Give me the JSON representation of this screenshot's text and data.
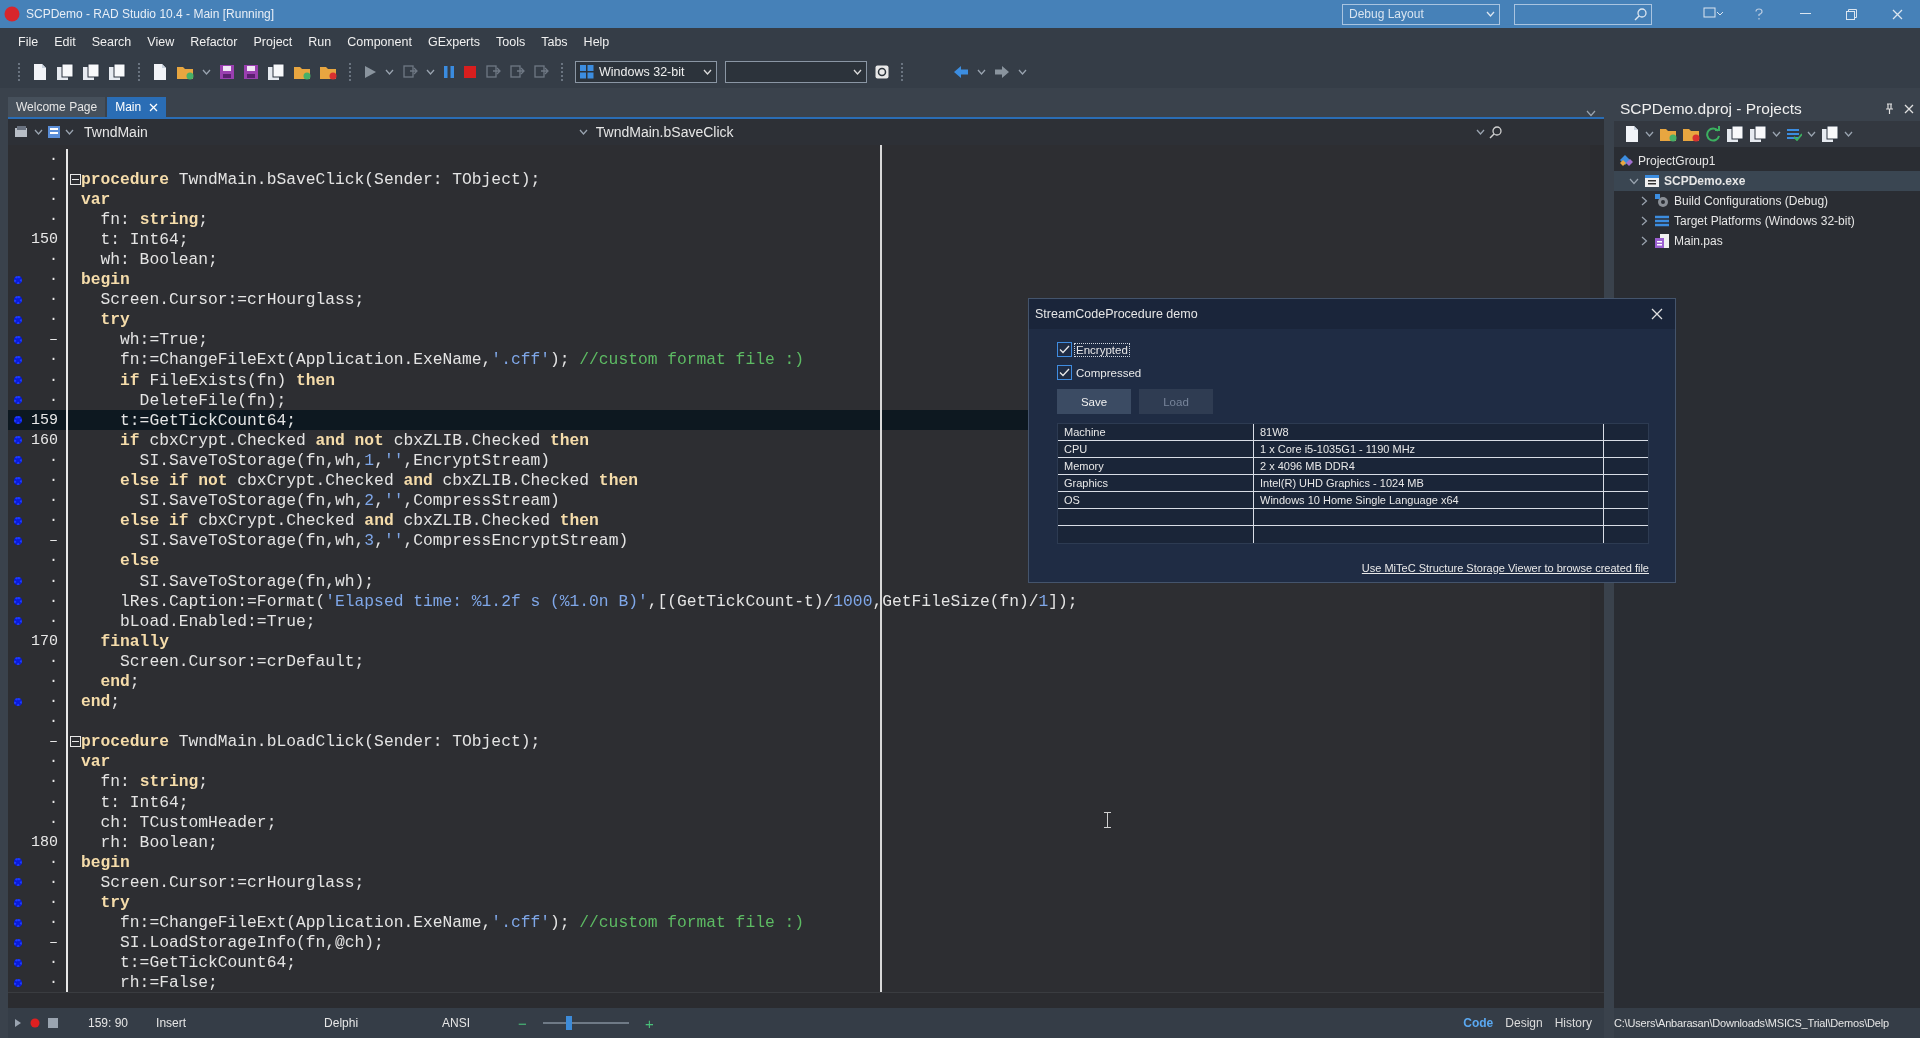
{
  "window": {
    "title": "SCPDemo - RAD Studio 10.4 - Main [Running]",
    "layout_combo": "Debug Layout"
  },
  "menu": [
    "File",
    "Edit",
    "Search",
    "View",
    "Refactor",
    "Project",
    "Run",
    "Component",
    "GExperts",
    "Tools",
    "Tabs",
    "Help"
  ],
  "toolbar": {
    "platform_combo": "Windows 32-bit"
  },
  "doc_tabs": [
    {
      "label": "Welcome Page",
      "selected": false
    },
    {
      "label": "Main",
      "selected": true
    }
  ],
  "editor": {
    "class_combo": "TwndMain",
    "method_combo": "TwndMain.bSaveClick",
    "lines": [
      {
        "gutter": "·",
        "compiled": false,
        "current": false,
        "fold": false
      },
      {
        "gutter": "·",
        "compiled": false,
        "current": false,
        "fold": true,
        "code": [
          {
            "kind": "kw",
            "text": "procedure"
          },
          {
            "kind": "plain",
            "text": " TwndMain.bSaveClick(Sender: TObject);"
          }
        ]
      },
      {
        "gutter": "·",
        "compiled": false,
        "current": false,
        "fold": false,
        "code": [
          {
            "kind": "kw",
            "text": "var"
          }
        ]
      },
      {
        "gutter": "·",
        "compiled": false,
        "current": false,
        "fold": false,
        "code": [
          {
            "kind": "plain",
            "text": "  fn: "
          },
          {
            "kind": "kw",
            "text": "string"
          },
          {
            "kind": "plain",
            "text": ";"
          }
        ]
      },
      {
        "gutter": "150",
        "compiled": false,
        "current": false,
        "fold": false,
        "code": [
          {
            "kind": "plain",
            "text": "  t: Int64;"
          }
        ]
      },
      {
        "gutter": "·",
        "compiled": false,
        "current": false,
        "fold": false,
        "code": [
          {
            "kind": "plain",
            "text": "  wh: Boolean;"
          }
        ]
      },
      {
        "gutter": "·",
        "compiled": true,
        "current": false,
        "fold": false,
        "code": [
          {
            "kind": "kw",
            "text": "begin"
          }
        ]
      },
      {
        "gutter": "·",
        "compiled": true,
        "current": false,
        "fold": false,
        "code": [
          {
            "kind": "plain",
            "text": "  Screen.Cursor:=crHourglass;"
          }
        ]
      },
      {
        "gutter": "·",
        "compiled": true,
        "current": false,
        "fold": false,
        "code": [
          {
            "kind": "kw",
            "text": "  try"
          }
        ]
      },
      {
        "gutter": "–",
        "compiled": true,
        "current": false,
        "fold": false,
        "code": [
          {
            "kind": "plain",
            "text": "    wh:=True;"
          }
        ]
      },
      {
        "gutter": "·",
        "compiled": true,
        "current": false,
        "fold": false,
        "code": [
          {
            "kind": "plain",
            "text": "    fn:=ChangeFileExt(Application.ExeName,"
          },
          {
            "kind": "str",
            "text": "'.cff'"
          },
          {
            "kind": "plain",
            "text": "); "
          },
          {
            "kind": "cmt",
            "text": "//custom format file :)"
          }
        ]
      },
      {
        "gutter": "·",
        "compiled": true,
        "current": false,
        "fold": false,
        "code": [
          {
            "kind": "kw",
            "text": "    if"
          },
          {
            "kind": "plain",
            "text": " FileExists(fn) "
          },
          {
            "kind": "kw",
            "text": "then"
          }
        ]
      },
      {
        "gutter": "·",
        "compiled": true,
        "current": false,
        "fold": false,
        "code": [
          {
            "kind": "plain",
            "text": "      DeleteFile(fn);"
          }
        ]
      },
      {
        "gutter": "159",
        "compiled": true,
        "current": true,
        "fold": false,
        "code": [
          {
            "kind": "plain",
            "text": "    t:=GetTickCount64;"
          }
        ]
      },
      {
        "gutter": "160",
        "compiled": true,
        "current": false,
        "fold": false,
        "code": [
          {
            "kind": "kw",
            "text": "    if"
          },
          {
            "kind": "plain",
            "text": " cbxCrypt.Checked "
          },
          {
            "kind": "kw",
            "text": "and not"
          },
          {
            "kind": "plain",
            "text": " cbxZLIB.Checked "
          },
          {
            "kind": "kw",
            "text": "then"
          }
        ]
      },
      {
        "gutter": "·",
        "compiled": true,
        "current": false,
        "fold": false,
        "code": [
          {
            "kind": "plain",
            "text": "      SI.SaveToStorage(fn,wh,"
          },
          {
            "kind": "num",
            "text": "1"
          },
          {
            "kind": "plain",
            "text": ","
          },
          {
            "kind": "str",
            "text": "''"
          },
          {
            "kind": "plain",
            "text": ",EncryptStream)"
          }
        ]
      },
      {
        "gutter": "·",
        "compiled": true,
        "current": false,
        "fold": false,
        "code": [
          {
            "kind": "kw",
            "text": "    else if not"
          },
          {
            "kind": "plain",
            "text": " cbxCrypt.Checked "
          },
          {
            "kind": "kw",
            "text": "and"
          },
          {
            "kind": "plain",
            "text": " cbxZLIB.Checked "
          },
          {
            "kind": "kw",
            "text": "then"
          }
        ]
      },
      {
        "gutter": "·",
        "compiled": true,
        "current": false,
        "fold": false,
        "code": [
          {
            "kind": "plain",
            "text": "      SI.SaveToStorage(fn,wh,"
          },
          {
            "kind": "num",
            "text": "2"
          },
          {
            "kind": "plain",
            "text": ","
          },
          {
            "kind": "str",
            "text": "''"
          },
          {
            "kind": "plain",
            "text": ",CompressStream)"
          }
        ]
      },
      {
        "gutter": "·",
        "compiled": true,
        "current": false,
        "fold": false,
        "code": [
          {
            "kind": "kw",
            "text": "    else if"
          },
          {
            "kind": "plain",
            "text": " cbxCrypt.Checked "
          },
          {
            "kind": "kw",
            "text": "and"
          },
          {
            "kind": "plain",
            "text": " cbxZLIB.Checked "
          },
          {
            "kind": "kw",
            "text": "then"
          }
        ]
      },
      {
        "gutter": "–",
        "compiled": true,
        "current": false,
        "fold": false,
        "code": [
          {
            "kind": "plain",
            "text": "      SI.SaveToStorage(fn,wh,"
          },
          {
            "kind": "num",
            "text": "3"
          },
          {
            "kind": "plain",
            "text": ","
          },
          {
            "kind": "str",
            "text": "''"
          },
          {
            "kind": "plain",
            "text": ",CompressEncryptStream)"
          }
        ]
      },
      {
        "gutter": "·",
        "compiled": false,
        "current": false,
        "fold": false,
        "code": [
          {
            "kind": "kw",
            "text": "    else"
          }
        ]
      },
      {
        "gutter": "·",
        "compiled": true,
        "current": false,
        "fold": false,
        "code": [
          {
            "kind": "plain",
            "text": "      SI.SaveToStorage(fn,wh);"
          }
        ]
      },
      {
        "gutter": "·",
        "compiled": true,
        "current": false,
        "fold": false,
        "code": [
          {
            "kind": "plain",
            "text": "    lRes.Caption:=Format("
          },
          {
            "kind": "str",
            "text": "'Elapsed time: %1.2f s (%1.0n B)'"
          },
          {
            "kind": "plain",
            "text": ",[(GetTickCount-t)/"
          },
          {
            "kind": "num",
            "text": "1000"
          },
          {
            "kind": "plain",
            "text": ",GetFileSize(fn)/"
          },
          {
            "kind": "num",
            "text": "1"
          },
          {
            "kind": "plain",
            "text": "]);"
          }
        ]
      },
      {
        "gutter": "·",
        "compiled": true,
        "current": false,
        "fold": false,
        "code": [
          {
            "kind": "plain",
            "text": "    bLoad.Enabled:=True;"
          }
        ]
      },
      {
        "gutter": "170",
        "compiled": false,
        "current": false,
        "fold": false,
        "code": [
          {
            "kind": "kw",
            "text": "  finally"
          }
        ]
      },
      {
        "gutter": "·",
        "compiled": true,
        "current": false,
        "fold": false,
        "code": [
          {
            "kind": "plain",
            "text": "    Screen.Cursor:=crDefault;"
          }
        ]
      },
      {
        "gutter": "·",
        "compiled": false,
        "current": false,
        "fold": false,
        "code": [
          {
            "kind": "kw",
            "text": "  end"
          },
          {
            "kind": "plain",
            "text": ";"
          }
        ]
      },
      {
        "gutter": "·",
        "compiled": true,
        "current": false,
        "fold": false,
        "code": [
          {
            "kind": "kw",
            "text": "end"
          },
          {
            "kind": "plain",
            "text": ";"
          }
        ]
      },
      {
        "gutter": "·",
        "compiled": false,
        "current": false,
        "fold": false
      },
      {
        "gutter": "–",
        "compiled": false,
        "current": false,
        "fold": true,
        "code": [
          {
            "kind": "kw",
            "text": "procedure"
          },
          {
            "kind": "plain",
            "text": " TwndMain.bLoadClick(Sender: TObject);"
          }
        ]
      },
      {
        "gutter": "·",
        "compiled": false,
        "current": false,
        "fold": false,
        "code": [
          {
            "kind": "kw",
            "text": "var"
          }
        ]
      },
      {
        "gutter": "·",
        "compiled": false,
        "current": false,
        "fold": false,
        "code": [
          {
            "kind": "plain",
            "text": "  fn: "
          },
          {
            "kind": "kw",
            "text": "string"
          },
          {
            "kind": "plain",
            "text": ";"
          }
        ]
      },
      {
        "gutter": "·",
        "compiled": false,
        "current": false,
        "fold": false,
        "code": [
          {
            "kind": "plain",
            "text": "  t: Int64;"
          }
        ]
      },
      {
        "gutter": "·",
        "compiled": false,
        "current": false,
        "fold": false,
        "code": [
          {
            "kind": "plain",
            "text": "  ch: TCustomHeader;"
          }
        ]
      },
      {
        "gutter": "180",
        "compiled": false,
        "current": false,
        "fold": false,
        "code": [
          {
            "kind": "plain",
            "text": "  rh: Boolean;"
          }
        ]
      },
      {
        "gutter": "·",
        "compiled": true,
        "current": false,
        "fold": false,
        "code": [
          {
            "kind": "kw",
            "text": "begin"
          }
        ]
      },
      {
        "gutter": "·",
        "compiled": true,
        "current": false,
        "fold": false,
        "code": [
          {
            "kind": "plain",
            "text": "  Screen.Cursor:=crHourglass;"
          }
        ]
      },
      {
        "gutter": "·",
        "compiled": true,
        "current": false,
        "fold": false,
        "code": [
          {
            "kind": "kw",
            "text": "  try"
          }
        ]
      },
      {
        "gutter": "·",
        "compiled": true,
        "current": false,
        "fold": false,
        "code": [
          {
            "kind": "plain",
            "text": "    fn:=ChangeFileExt(Application.ExeName,"
          },
          {
            "kind": "str",
            "text": "'.cff'"
          },
          {
            "kind": "plain",
            "text": "); "
          },
          {
            "kind": "cmt",
            "text": "//custom format file :)"
          }
        ]
      },
      {
        "gutter": "–",
        "compiled": true,
        "current": false,
        "fold": false,
        "code": [
          {
            "kind": "plain",
            "text": "    SI.LoadStorageInfo(fn,@ch);"
          }
        ]
      },
      {
        "gutter": "·",
        "compiled": true,
        "current": false,
        "fold": false,
        "code": [
          {
            "kind": "plain",
            "text": "    t:=GetTickCount64;"
          }
        ]
      },
      {
        "gutter": "·",
        "compiled": true,
        "current": false,
        "fold": false,
        "code": [
          {
            "kind": "plain",
            "text": "    rh:=False;"
          }
        ]
      }
    ]
  },
  "status_bar": {
    "position": "159: 90",
    "mode": "Insert",
    "language": "Delphi",
    "encoding": "ANSI",
    "zoom_out": "−",
    "zoom_in": "+",
    "zoom": {
      "level": 0.3
    },
    "view_tabs": [
      {
        "label": "Code",
        "selected": true
      },
      {
        "label": "Design",
        "selected": false
      },
      {
        "label": "History",
        "selected": false
      }
    ]
  },
  "projects": {
    "title": "SCPDemo.dproj - Projects",
    "path": "C:\\Users\\Anbarasan\\Downloads\\MSICS_Trial\\Demos\\Delp",
    "tree": [
      {
        "label": "ProjectGroup1",
        "kind": "group",
        "selected": false,
        "children": [
          {
            "label": "SCPDemo.exe",
            "kind": "exe",
            "selected": true,
            "expanded": true,
            "children": [
              {
                "label": "Build Configurations (Debug)",
                "kind": "config",
                "selected": false,
                "expanded": false
              },
              {
                "label": "Target Platforms (Windows 32-bit)",
                "kind": "platforms",
                "selected": false,
                "expanded": false
              },
              {
                "label": "Main.pas",
                "kind": "unit",
                "selected": false,
                "expanded": false
              }
            ]
          }
        ]
      }
    ]
  },
  "dialog": {
    "title": "StreamCodeProcedure demo",
    "options": [
      {
        "label": "Encrypted",
        "checked": true,
        "focused": true
      },
      {
        "label": "Compressed",
        "checked": true,
        "focused": false
      }
    ],
    "buttons": [
      {
        "label": "Save",
        "disabled": false
      },
      {
        "label": "Load",
        "disabled": true
      }
    ],
    "info_rows": [
      {
        "property": "Machine",
        "value": "81W8"
      },
      {
        "property": "CPU",
        "value": "1 x Core i5-1035G1 - 1190 MHz"
      },
      {
        "property": "Memory",
        "value": "2 x 4096 MB DDR4"
      },
      {
        "property": "Graphics",
        "value": "Intel(R) UHD Graphics - 1024 MB"
      },
      {
        "property": "OS",
        "value": "Windows 10 Home Single Language x64"
      }
    ],
    "link": "Use MiTeC Structure Storage Viewer to browse created file"
  }
}
